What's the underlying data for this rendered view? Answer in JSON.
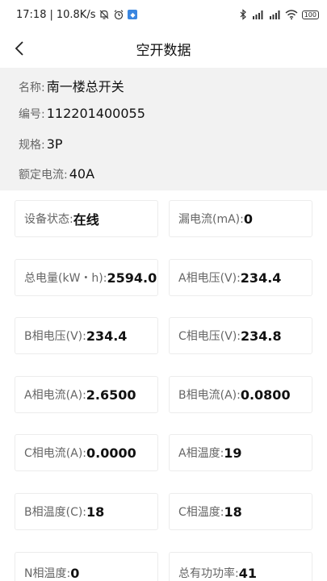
{
  "status_bar": {
    "time": "17:18",
    "speed": "10.8K/s",
    "battery": "100",
    "icons": [
      "mute-bell-icon",
      "alarm-icon",
      "app-badge-icon",
      "bluetooth-icon",
      "signal-hd-1-icon",
      "signal-hd-2-icon",
      "wifi-icon",
      "battery-icon"
    ]
  },
  "nav": {
    "title": "空开数据",
    "back_icon": "chevron-left-icon"
  },
  "info": {
    "name_label": "名称:",
    "name_value": "南一楼总开关",
    "code_label": "编号:",
    "code_value": "112201400055",
    "spec_label": "规格:",
    "spec_value": "3P",
    "current_label": "额定电流:",
    "current_value": "40A"
  },
  "cards": [
    {
      "label": "设备状态:",
      "value": "在线"
    },
    {
      "label": "漏电流(mA):",
      "value": "0"
    },
    {
      "label": "总电量(kW・h):",
      "value": "2594.05"
    },
    {
      "label": "A相电压(V):",
      "value": "234.4"
    },
    {
      "label": "B相电压(V):",
      "value": "234.4"
    },
    {
      "label": "C相电压(V):",
      "value": "234.8"
    },
    {
      "label": "A相电流(A):",
      "value": "2.6500"
    },
    {
      "label": "B相电流(A):",
      "value": "0.0800"
    },
    {
      "label": "C相电流(A):",
      "value": "0.0000"
    },
    {
      "label": "A相温度:",
      "value": "19"
    },
    {
      "label": "B相温度(C):",
      "value": "18"
    },
    {
      "label": "C相温度:",
      "value": "18"
    },
    {
      "label": "N相温度:",
      "value": "0"
    },
    {
      "label": "总有功功率:",
      "value": "41"
    }
  ]
}
